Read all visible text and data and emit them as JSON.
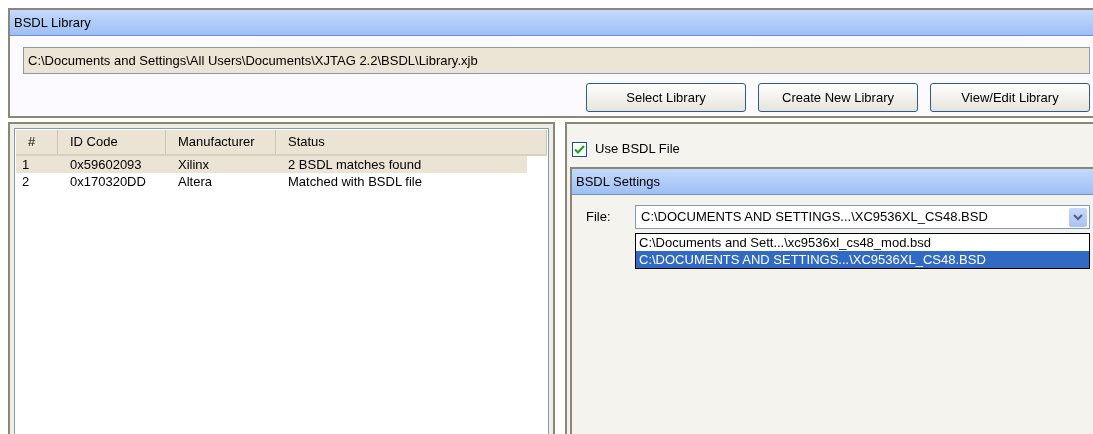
{
  "library_panel": {
    "title": "BSDL Library",
    "path": "C:\\Documents and Settings\\All Users\\Documents\\XJTAG 2.2\\BSDL\\Library.xjb",
    "buttons": [
      "Select Library",
      "Create New Library",
      "View/Edit Library"
    ]
  },
  "device_table": {
    "columns": [
      "#",
      "ID Code",
      "Manufacturer",
      "Status"
    ],
    "rows": [
      {
        "cells": [
          "1",
          "0x59602093",
          "Xilinx",
          "2 BSDL matches found"
        ],
        "selected": true
      },
      {
        "cells": [
          "2",
          "0x170320DD",
          "Altera",
          "Matched with BSDL file"
        ],
        "selected": false
      }
    ]
  },
  "use_bsdl_file": {
    "label": "Use BSDL File",
    "checked": true
  },
  "bsdl_settings": {
    "title": "BSDL Settings",
    "file_label": "File:",
    "file_value": "C:\\DOCUMENTS AND SETTINGS...\\XC9536XL_CS48.BSD",
    "options": [
      {
        "label": "C:\\Documents and Sett...\\xc9536xl_cs48_mod.bsd",
        "selected": false
      },
      {
        "label": "C:\\DOCUMENTS AND SETTINGS...\\XC9536XL_CS48.BSD",
        "selected": true
      }
    ]
  }
}
